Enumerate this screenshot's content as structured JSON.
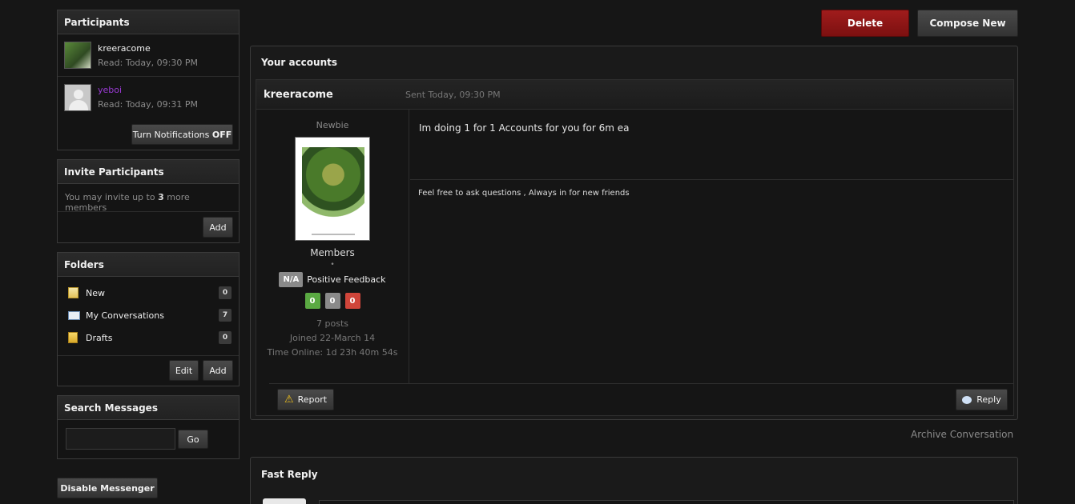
{
  "sidebar": {
    "participants": {
      "title": "Participants",
      "people": [
        {
          "name": "kreeracome",
          "read": "Read: Today, 09:30 PM"
        },
        {
          "name": "yeboi",
          "read": "Read: Today, 09:31 PM"
        }
      ],
      "notif_label": "Turn Notifications",
      "notif_state": "OFF"
    },
    "invite": {
      "title": "Invite Participants",
      "text_pre": "You may invite up to",
      "count": "3",
      "text_post": "more members",
      "add_label": "Add"
    },
    "folders": {
      "title": "Folders",
      "items": [
        {
          "label": "New",
          "count": "0",
          "icon": "folder-icon"
        },
        {
          "label": "My Conversations",
          "count": "7",
          "icon": "envelope-icon"
        },
        {
          "label": "Drafts",
          "count": "0",
          "icon": "folder-icon"
        }
      ],
      "edit_label": "Edit",
      "add_label": "Add"
    },
    "search": {
      "title": "Search Messages",
      "placeholder": "",
      "go_label": "Go"
    },
    "disable_label": "Disable Messenger"
  },
  "toolbar": {
    "delete_label": "Delete",
    "compose_label": "Compose New"
  },
  "conversation": {
    "title": "Your accounts",
    "author": "kreeracome",
    "sent": "Sent Today, 09:30 PM",
    "rank": "Newbie",
    "group": "Members",
    "dot": "•",
    "feedback_badge": "N/A",
    "feedback_label": "Positive Feedback",
    "fb_pos": "0",
    "fb_neu": "0",
    "fb_neg": "0",
    "posts": "7 posts",
    "joined": "Joined 22-March 14",
    "online": "Time Online: 1d 23h 40m 54s",
    "message": "Im doing 1 for 1 Accounts for you for 6m ea",
    "signature": "Feel free to ask questions , Always in for new friends",
    "report_label": "Report",
    "reply_label": "Reply"
  },
  "archive_label": "Archive Conversation",
  "fast_reply": {
    "title": "Fast Reply"
  },
  "colors": {
    "delete": "#8b1515",
    "yeboi_name": "#9b3bd6",
    "fb_pos": "#5aa942",
    "fb_neu": "#8a8a8a",
    "fb_neg": "#d0453a"
  }
}
